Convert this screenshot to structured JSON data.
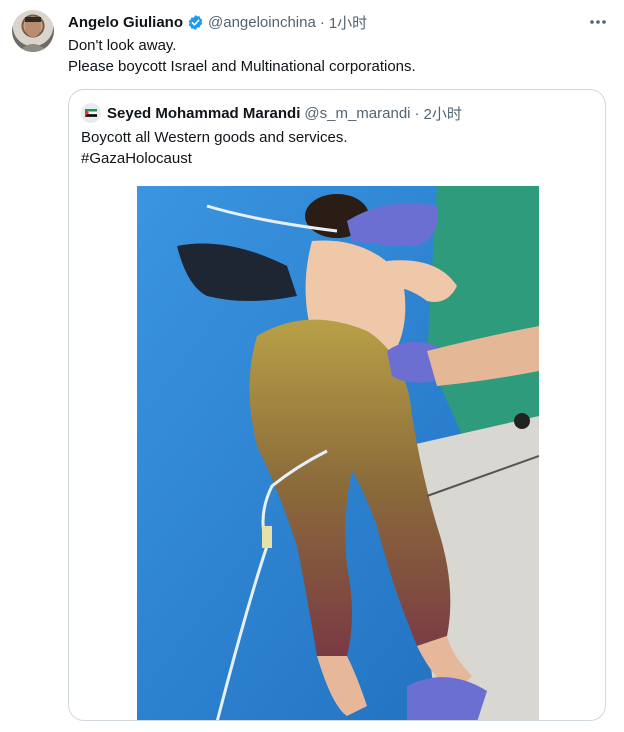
{
  "tweet": {
    "author_name": "Angelo Giuliano",
    "handle": "@angeloinchina",
    "separator": "·",
    "time": "1小时",
    "lines": [
      "Don't look away.",
      "Please boycott Israel and Multinational corporations."
    ]
  },
  "quote": {
    "author_name": "Seyed Mohammad Marandi",
    "handle": "@s_m_marandi",
    "separator": "·",
    "time": "2小时",
    "lines": [
      "Boycott all Western goods and services.",
      "#GazaHolocaust"
    ]
  },
  "icons": {
    "verified": "verified-badge-icon",
    "more": "more-options-icon"
  },
  "colors": {
    "verified_blue": "#1d9bf0",
    "text": "#0f1419",
    "muted": "#536471",
    "border": "#cfd9de"
  }
}
